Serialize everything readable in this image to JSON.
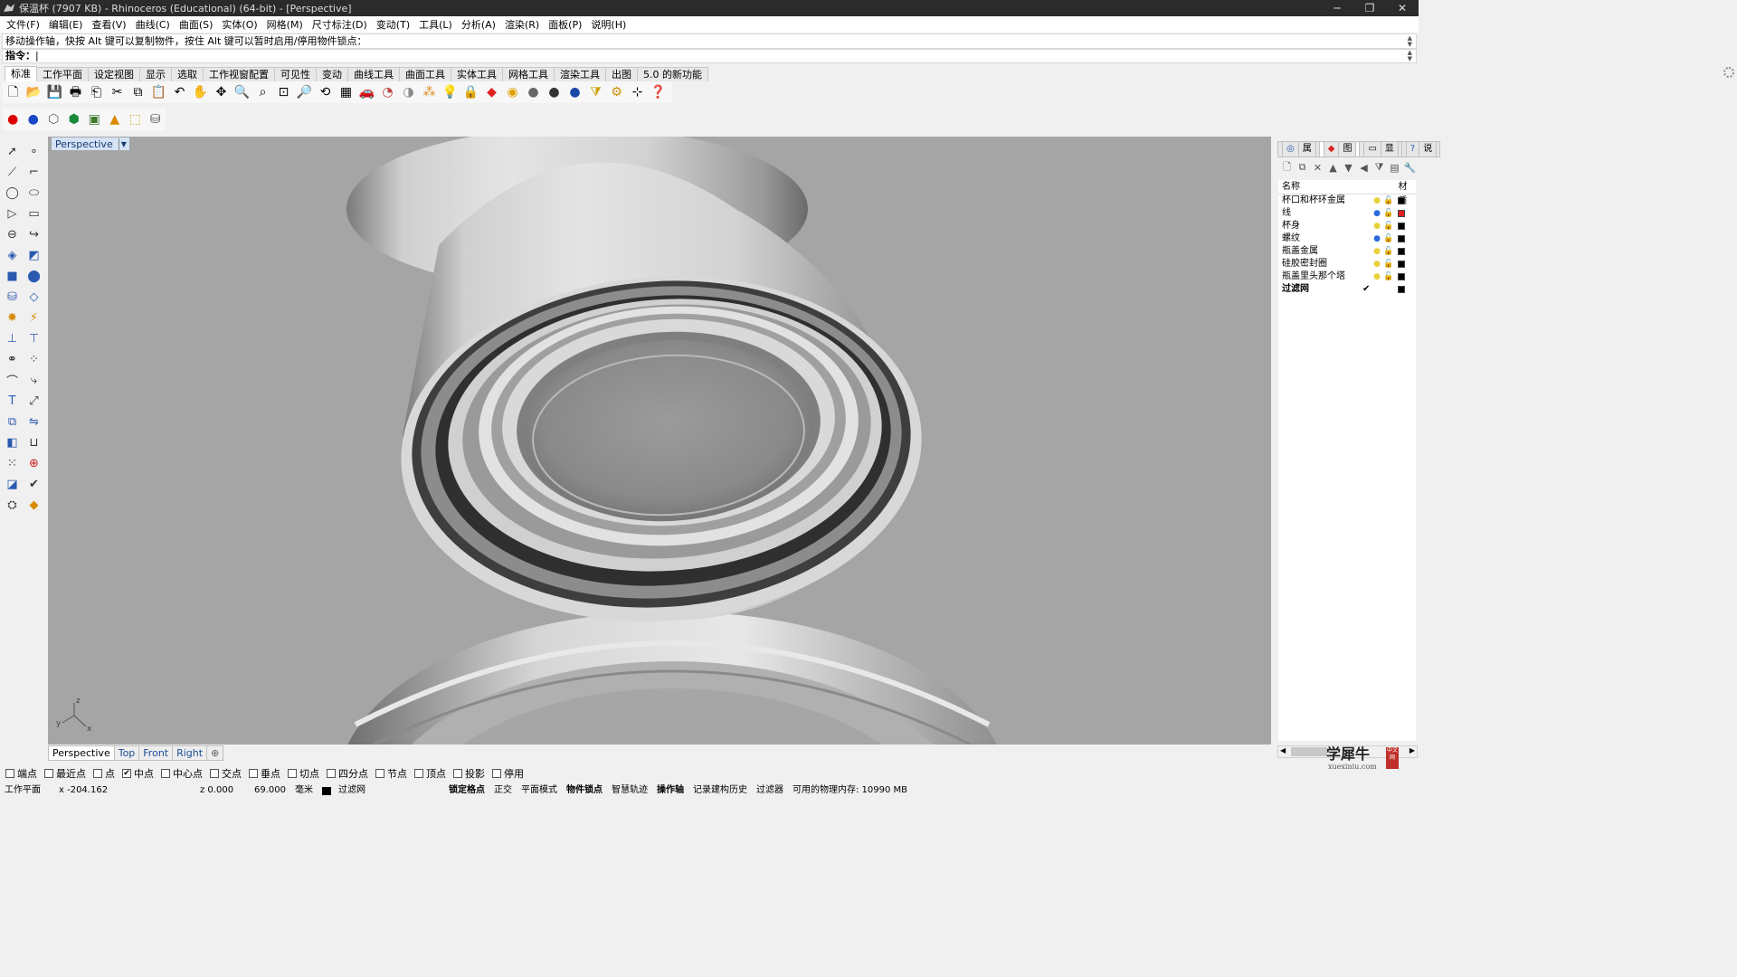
{
  "window": {
    "title": "保温杯 (7907 KB) - Rhinoceros (Educational) (64-bit) - [Perspective]",
    "min_label": "─",
    "max_label": "❐",
    "close_label": "✕"
  },
  "menu": [
    "文件(F)",
    "编辑(E)",
    "查看(V)",
    "曲线(C)",
    "曲面(S)",
    "实体(O)",
    "网格(M)",
    "尺寸标注(D)",
    "变动(T)",
    "工具(L)",
    "分析(A)",
    "渲染(R)",
    "面板(P)",
    "说明(H)"
  ],
  "command": {
    "history": "移动操作轴，快按 Alt 键可以复制物件，按住 Alt 键可以暂时启用/停用物件锁点：",
    "prompt": "指令："
  },
  "toolbar_tabs": [
    "标准",
    "工作平面",
    "设定视图",
    "显示",
    "选取",
    "工作视窗配置",
    "可见性",
    "变动",
    "曲线工具",
    "曲面工具",
    "实体工具",
    "网格工具",
    "渲染工具",
    "出图",
    "5.0 的新功能"
  ],
  "toolbar_icons_row1": [
    "new-file-icon",
    "open-folder-icon",
    "save-icon",
    "print-icon",
    "import-icon",
    "cut-icon",
    "copy-icon",
    "paste-icon",
    "undo-icon",
    "pan-hand-icon",
    "move-view-icon",
    "zoom-icon",
    "zoom-window-icon",
    "zoom-extents-icon",
    "zoom-selected-icon",
    "rotate-view-icon",
    "four-viewports-icon",
    "car-icon",
    "hide-icon",
    "show-icon",
    "select-points-icon",
    "lightbulb-icon",
    "lock-icon",
    "layer-icon",
    "color-wheel-icon",
    "shade-sphere-icon",
    "rendered-sphere-icon",
    "render-sphere-icon",
    "filter-icon",
    "options-gear-icon",
    "osnap-icon",
    "help-icon"
  ],
  "toolbar_icons_row2": [
    "red-sphere-icon",
    "blue-sphere-icon",
    "box-icon",
    "materials-icon",
    "texture-mapping-icon",
    "cone-icon",
    "bounding-box-icon",
    "cylinder-icon"
  ],
  "viewport": {
    "label": "Perspective",
    "axis_z": "z",
    "axis_y": "y",
    "axis_x": "x"
  },
  "viewport_tabs": [
    "Perspective",
    "Top",
    "Front",
    "Right",
    "⊕"
  ],
  "osnap": [
    {
      "label": "端点",
      "checked": false
    },
    {
      "label": "最近点",
      "checked": false
    },
    {
      "label": "点",
      "checked": false
    },
    {
      "label": "中点",
      "checked": true
    },
    {
      "label": "中心点",
      "checked": false
    },
    {
      "label": "交点",
      "checked": false
    },
    {
      "label": "垂点",
      "checked": false
    },
    {
      "label": "切点",
      "checked": false
    },
    {
      "label": "四分点",
      "checked": false
    },
    {
      "label": "节点",
      "checked": false
    },
    {
      "label": "顶点",
      "checked": false
    },
    {
      "label": "投影",
      "checked": false
    },
    {
      "label": "停用",
      "checked": false
    }
  ],
  "status": {
    "cplane": "工作平面",
    "x": "x -204.162",
    "z": "z 0.000",
    "distance": "69.000",
    "units": "毫米",
    "layer": "过滤网",
    "toggles": [
      "锁定格点",
      "正交",
      "平面模式",
      "物件锁点",
      "智慧轨迹",
      "操作轴",
      "记录建构历史",
      "过滤器"
    ],
    "memory": "可用的物理内存: 10990 MB"
  },
  "panel": {
    "tabs": [
      "属",
      "图",
      "显",
      "说"
    ],
    "columns": {
      "name": "名称",
      "material": "材质"
    },
    "layers": [
      {
        "name": "杯口和杯环金属",
        "bulb": "#e8d23a",
        "color": "#000000",
        "current": false
      },
      {
        "name": "线",
        "bulb": "#2b6ad8",
        "color": "#e02020",
        "current": false
      },
      {
        "name": "杯身",
        "bulb": "#e8d23a",
        "color": "#000000",
        "current": false
      },
      {
        "name": "螺纹",
        "bulb": "#2b6ad8",
        "color": "#000000",
        "current": false
      },
      {
        "name": "瓶盖金属",
        "bulb": "#e8d23a",
        "color": "#000000",
        "current": false
      },
      {
        "name": "硅胶密封圈",
        "bulb": "#e8d23a",
        "color": "#000000",
        "current": false
      },
      {
        "name": "瓶盖里头那个塔",
        "bulb": "#e8d23a",
        "color": "#000000",
        "current": false
      },
      {
        "name": "过滤网",
        "bulb": "",
        "color": "#000000",
        "current": true,
        "check": "✔"
      }
    ]
  },
  "watermark": {
    "big": "学犀牛",
    "small": "xuexiniu.com",
    "seal": "中文网"
  }
}
